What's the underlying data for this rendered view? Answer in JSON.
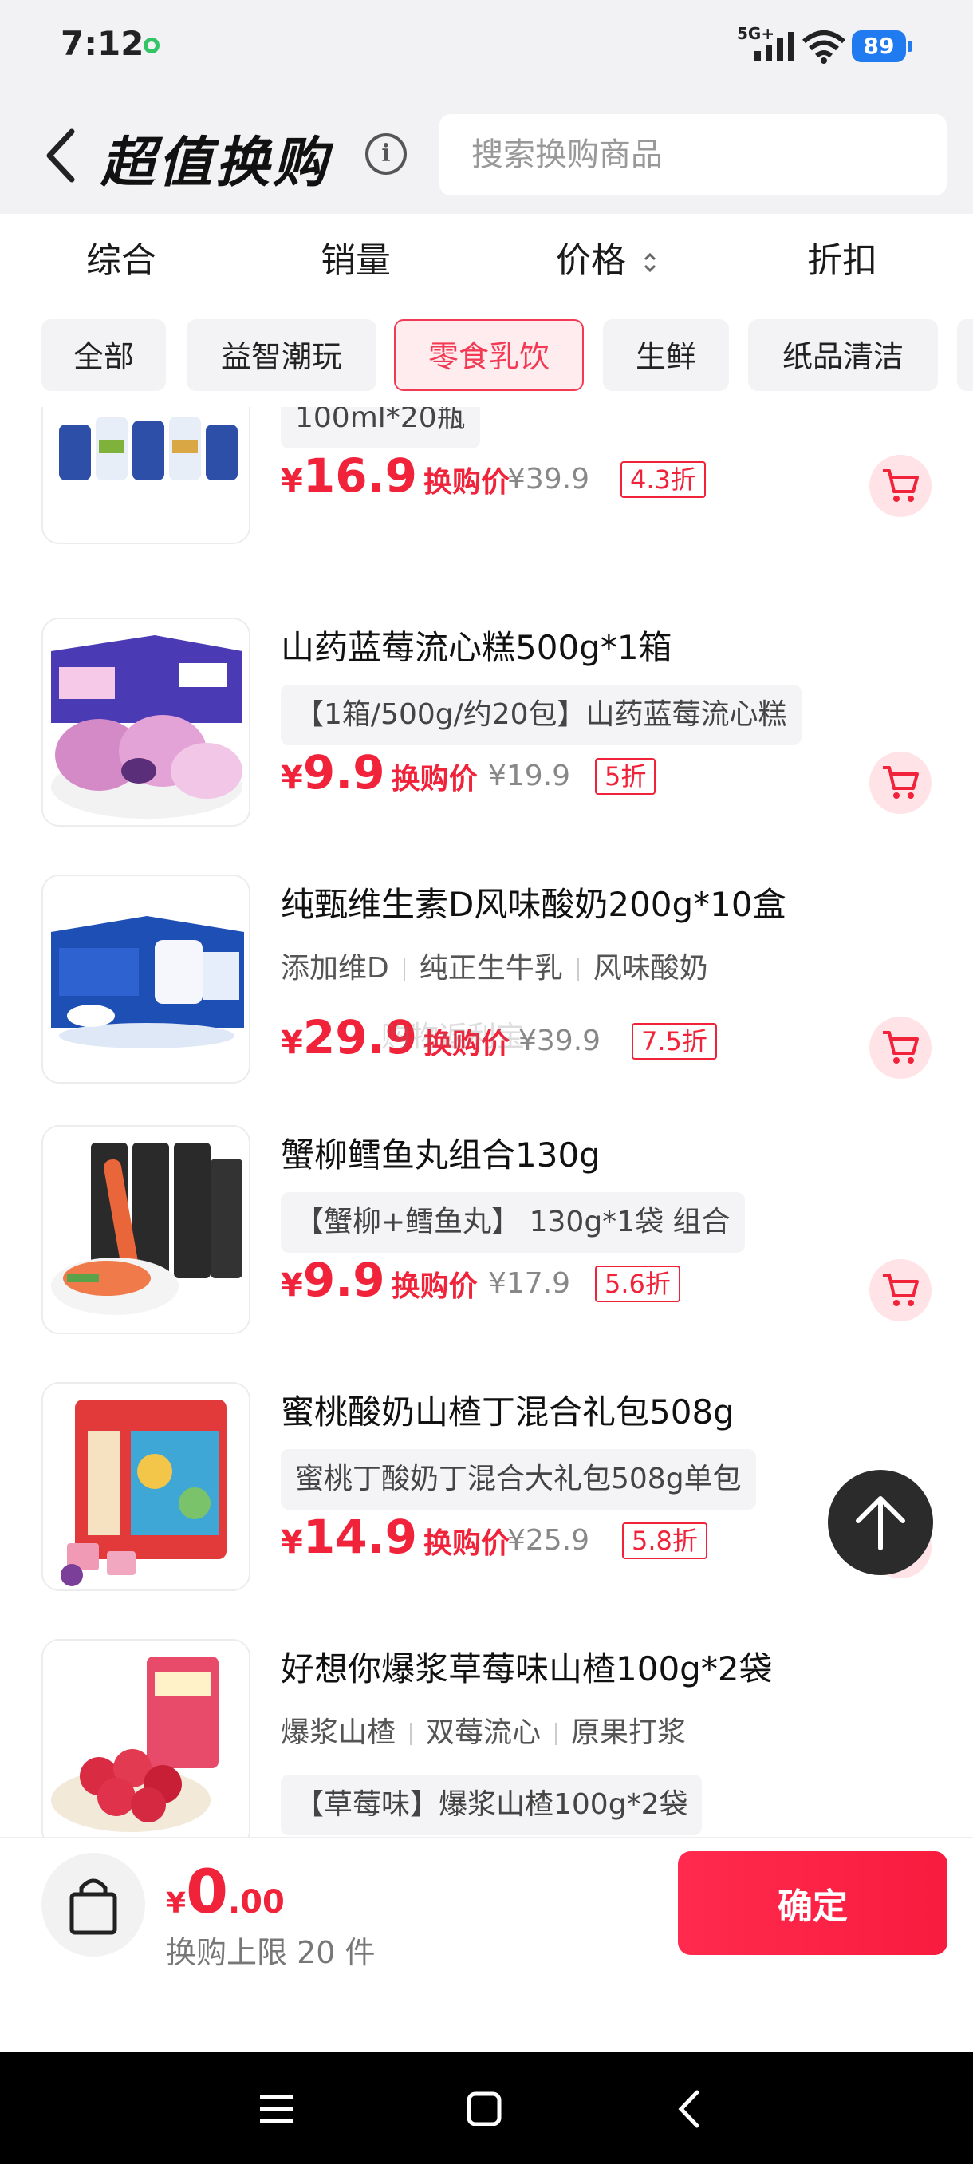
{
  "status_bar": {
    "time": "7:12",
    "network": "5G+",
    "battery": "89"
  },
  "header": {
    "title": "超值换购",
    "search_placeholder": "搜索换购商品"
  },
  "sort_tabs": [
    "综合",
    "销量",
    "价格",
    "折扣"
  ],
  "categories": [
    {
      "label": "全部",
      "active": false
    },
    {
      "label": "益智潮玩",
      "active": false
    },
    {
      "label": "零食乳饮",
      "active": true
    },
    {
      "label": "生鲜",
      "active": false
    },
    {
      "label": "纸品清洁",
      "active": false
    }
  ],
  "products": [
    {
      "title": "",
      "spec": "100ml*20瓶",
      "tags": [],
      "price_yen": "¥",
      "price": "16.9",
      "price_label": "换购价",
      "original": "¥39.9",
      "discount": "4.3折"
    },
    {
      "title": "山药蓝莓流心糕500g*1箱",
      "spec": "【1箱/500g/约20包】山药蓝莓流心糕",
      "tags": [],
      "price_yen": "¥",
      "price": "9.9",
      "price_label": "换购价",
      "original": "¥19.9",
      "discount": "5折"
    },
    {
      "title": "纯甄维生素D风味酸奶200g*10盒",
      "spec": "",
      "tags": [
        "添加维D",
        "纯正生牛乳",
        "风味酸奶"
      ],
      "price_yen": "¥",
      "price": "29.9",
      "price_label": "换购价",
      "original": "¥39.9",
      "discount": "7.5折"
    },
    {
      "title": "蟹柳鳕鱼丸组合130g",
      "spec": "【蟹柳+鳕鱼丸】 130g*1袋 组合",
      "tags": [],
      "price_yen": "¥",
      "price": "9.9",
      "price_label": "换购价",
      "original": "¥17.9",
      "discount": "5.6折"
    },
    {
      "title": "蜜桃酸奶山楂丁混合礼包508g",
      "spec": "蜜桃丁酸奶丁混合大礼包508g单包",
      "tags": [],
      "price_yen": "¥",
      "price": "14.9",
      "price_label": "换购价",
      "original": "¥25.9",
      "discount": "5.8折"
    },
    {
      "title": "好想你爆浆草莓味山楂100g*2袋",
      "spec": "【草莓味】爆浆山楂100g*2袋",
      "tags": [
        "爆浆山楂",
        "双莓流心",
        "原果打浆"
      ],
      "price_yen": "",
      "price": "",
      "price_label": "",
      "original": "",
      "discount": ""
    }
  ],
  "watermark": "购物返利宝",
  "bottom": {
    "yen": "¥",
    "total_int": "0",
    "total_dec": ".00",
    "limit": "换购上限 20 件",
    "confirm": "确定"
  },
  "colors": {
    "accent": "#f0233a",
    "chip_active_bg": "#ffecee",
    "header_bg": "#f2f2f4"
  },
  "icons": [
    "back-chevron-icon",
    "info-icon",
    "cart-icon",
    "shopping-bag-icon",
    "arrow-up-icon",
    "menu-icon",
    "home-square-icon",
    "back-triangle-icon"
  ]
}
